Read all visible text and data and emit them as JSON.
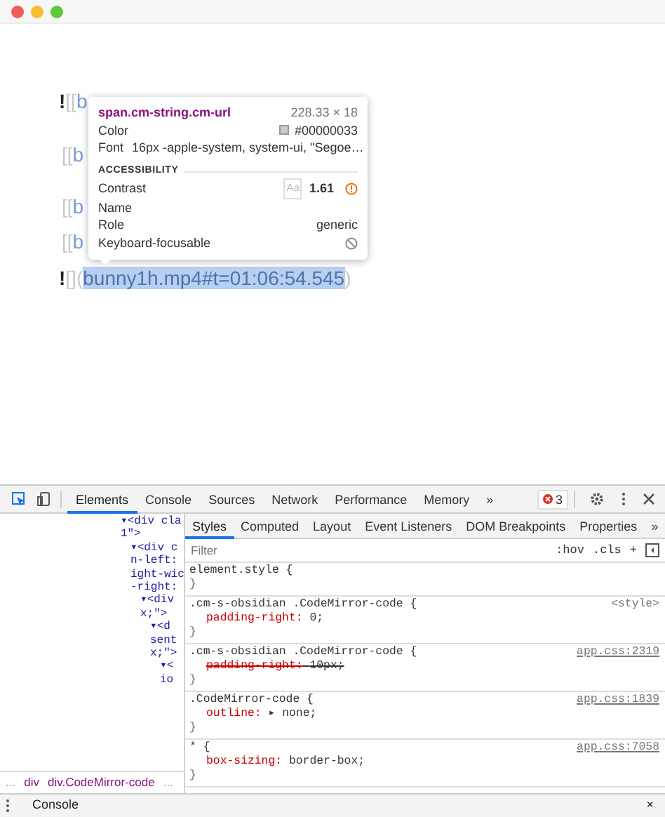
{
  "editor": {
    "lines": [
      {
        "segments": [
          {
            "kind": "bang",
            "text": "!"
          },
          {
            "kind": "mark",
            "text": "[["
          },
          {
            "kind": "link",
            "text": "b"
          }
        ]
      },
      {
        "segments": [
          {
            "kind": "mark",
            "text": "[["
          },
          {
            "kind": "link",
            "text": "b"
          }
        ]
      },
      {
        "segments": [
          {
            "kind": "mark",
            "text": "[["
          },
          {
            "kind": "link",
            "text": "b"
          }
        ]
      },
      {
        "segments": [
          {
            "kind": "mark",
            "text": "[["
          },
          {
            "kind": "link",
            "text": "b"
          }
        ]
      },
      {
        "segments": [
          {
            "kind": "bang",
            "text": "!"
          },
          {
            "kind": "mark",
            "text": "[]"
          },
          {
            "kind": "mark",
            "text": "("
          },
          {
            "kind": "url",
            "text": "bunny1h.mp4#t=01:06:54.545"
          },
          {
            "kind": "mark",
            "text": ")"
          }
        ]
      }
    ]
  },
  "tooltip": {
    "selector": "span.cm-string.cm-url",
    "size": "228.33 × 18",
    "rows": [
      {
        "label": "Color",
        "value": "#00000033",
        "kind": "color"
      },
      {
        "kind": "text",
        "label": "Font",
        "value": "16px -apple-system, system-ui, \"Segoe…"
      }
    ],
    "section": "ACCESSIBILITY",
    "a11y": [
      {
        "kind": "contrast",
        "label": "Contrast",
        "sample": "Aa",
        "value": "1.61"
      },
      {
        "kind": "plain",
        "label": "Name"
      },
      {
        "kind": "text",
        "label": "Role",
        "value": "generic"
      },
      {
        "kind": "blocked",
        "label": "Keyboard-focusable"
      }
    ]
  },
  "devtools": {
    "tabs": [
      {
        "label": "Elements",
        "selected": true
      },
      {
        "label": "Console",
        "selected": false
      },
      {
        "label": "Sources",
        "selected": false
      },
      {
        "label": "Network",
        "selected": false
      },
      {
        "label": "Performance",
        "selected": false
      },
      {
        "label": "Memory",
        "selected": false
      }
    ],
    "more": "»",
    "errors": "3",
    "tree": [
      {
        "lines": [
          "▾<div cla",
          "1\">"
        ],
        "children": [
          {
            "lines": [
              "▾<div c",
              "n-left:",
              "ight-wic",
              "-right:"
            ],
            "children": [
              {
                "lines": [
                  "▾<div",
                  "x;\">"
                ],
                "children": [
                  {
                    "lines": [
                      "▾<d",
                      "sent",
                      "x;\">"
                    ],
                    "children": [
                      {
                        "lines": [
                          "▾<",
                          "io"
                        ]
                      }
                    ]
                  }
                ]
              }
            ]
          }
        ]
      }
    ],
    "breadcrumbs": [
      {
        "text": "...",
        "kind": "more"
      },
      {
        "text": "div",
        "kind": "crumb"
      },
      {
        "text": "div.CodeMirror-code",
        "kind": "crumb"
      },
      {
        "text": "...",
        "kind": "more"
      }
    ],
    "styles_tabs": [
      {
        "label": "Styles",
        "selected": true
      },
      {
        "label": "Computed",
        "selected": false
      },
      {
        "label": "Layout",
        "selected": false
      },
      {
        "label": "Event Listeners",
        "selected": false
      },
      {
        "label": "DOM Breakpoints",
        "selected": false
      },
      {
        "label": "Properties",
        "selected": false
      }
    ],
    "styles_more": "»",
    "filter": {
      "placeholder": "Filter"
    },
    "hov": ":hov",
    "cls": ".cls",
    "plus": "+",
    "rules": [
      {
        "selector": "element.style {",
        "close": "}"
      },
      {
        "selector": ".cm-s-obsidian .CodeMirror-code {",
        "source": "<style>",
        "decls": [
          {
            "prop": "padding-right:",
            "value": "0;",
            "struck": false
          }
        ],
        "close": "}"
      },
      {
        "selector": ".cm-s-obsidian .CodeMirror-code {",
        "source": "app.css:2319",
        "decls": [
          {
            "prop": "padding-right:",
            "value": "10px;",
            "struck": true
          }
        ],
        "close": "}"
      },
      {
        "selector": ".CodeMirror-code {",
        "source": "app.css:1839",
        "decls": [
          {
            "prop": "outline:",
            "value": "▸ none;",
            "struck": false
          }
        ],
        "close": "}"
      },
      {
        "selector": "* {",
        "source": "app.css:7058",
        "decls": [
          {
            "prop": "box-sizing:",
            "value": "border-box;",
            "struck": false
          }
        ],
        "close": "}"
      }
    ],
    "drawer": {
      "tab": "Console",
      "close": "×"
    }
  }
}
